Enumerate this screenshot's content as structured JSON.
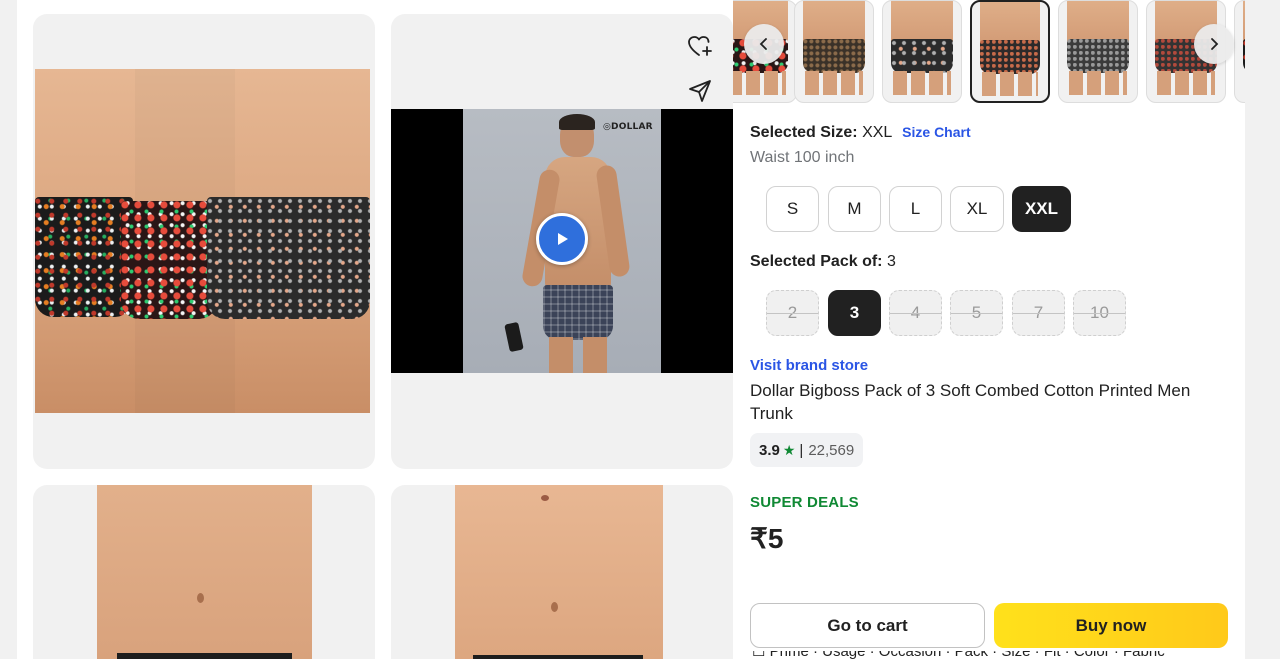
{
  "product": {
    "title": "Dollar Bigboss Pack of 3 Soft Combed Cotton Printed Men Trunk",
    "brand_store_label": "Visit brand store",
    "rating": "3.9",
    "rating_star": "★",
    "rating_separator": "|",
    "rating_count": "22,569",
    "deal_label": "SUPER DEALS",
    "price": "₹5",
    "cutoff_text": "☐ Prime · Usage · Occasion · Pack · Size · Fit · Color · Fabric"
  },
  "video": {
    "brand_logo": "◎DOLLAR"
  },
  "size": {
    "label": "Selected Size:",
    "value": "XXL",
    "chart_link": "Size Chart",
    "waist_text": "Waist 100 inch",
    "options": [
      "S",
      "M",
      "L",
      "XL",
      "XXL"
    ],
    "selected": "XXL"
  },
  "pack": {
    "label": "Selected Pack of:",
    "value": "3",
    "options": [
      "2",
      "3",
      "4",
      "5",
      "7",
      "10"
    ],
    "selected": "3"
  },
  "actions": {
    "go_to_cart": "Go to cart",
    "buy_now": "Buy now"
  },
  "icons": {
    "wishlist": "heart-plus-icon",
    "share": "share-icon",
    "play": "play-icon",
    "prev": "chevron-left-icon",
    "next": "chevron-right-icon"
  },
  "colors": {
    "accent_blue": "#2a55e5",
    "deal_green": "#108934",
    "buy_yellow": "#ffd81a",
    "dark": "#212121"
  }
}
